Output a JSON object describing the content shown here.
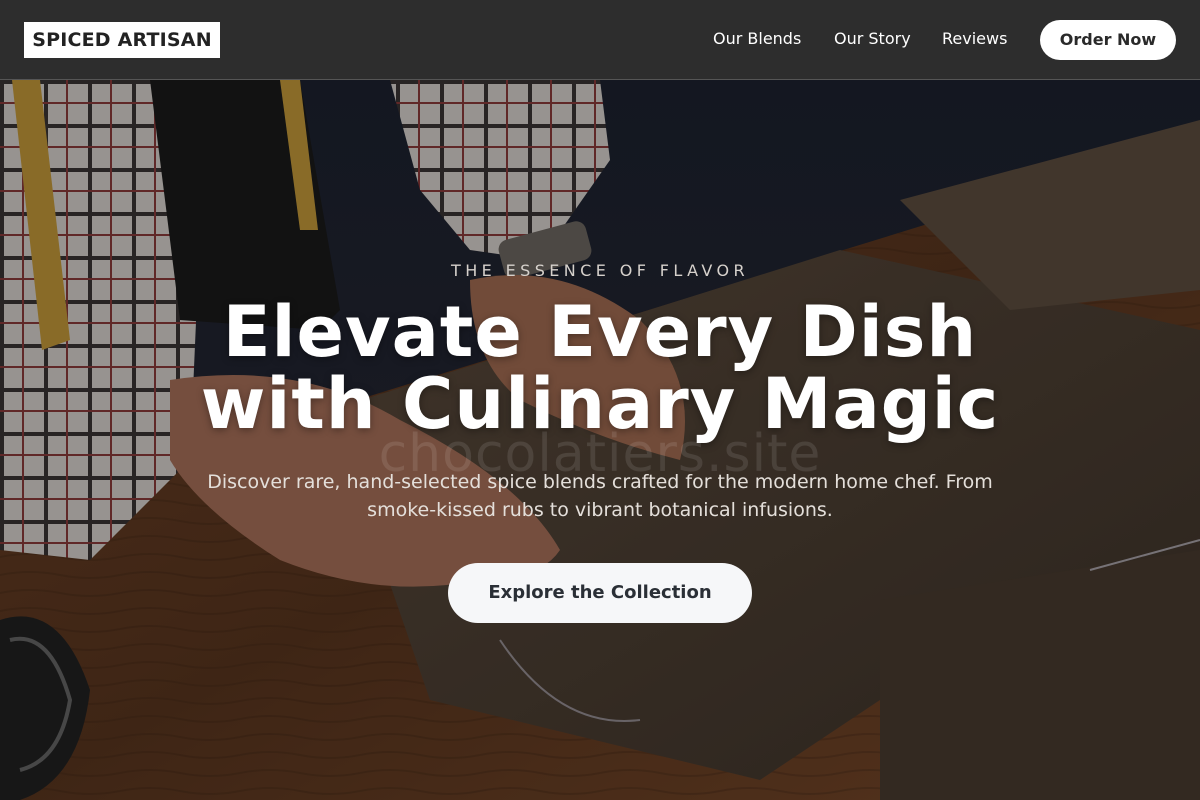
{
  "header": {
    "brand": "SPICED ARTISAN",
    "nav": [
      {
        "label": "Our Blends"
      },
      {
        "label": "Our Story"
      },
      {
        "label": "Reviews"
      }
    ],
    "cta_label": "Order Now"
  },
  "hero": {
    "eyebrow": "THE ESSENCE OF FLAVOR",
    "headline_line1": "Elevate Every Dish",
    "headline_line2": "with Culinary Magic",
    "watermark": "chocolatiers.site",
    "subheadline": "Discover rare, hand-selected spice blends crafted for the modern home chef. From smoke-kissed rubs to vibrant botanical infusions.",
    "cta_label": "Explore the Collection"
  },
  "colors": {
    "header_bg": "#2d2d2d",
    "button_bg": "#ffffff",
    "button_text": "#2a2a2a"
  }
}
